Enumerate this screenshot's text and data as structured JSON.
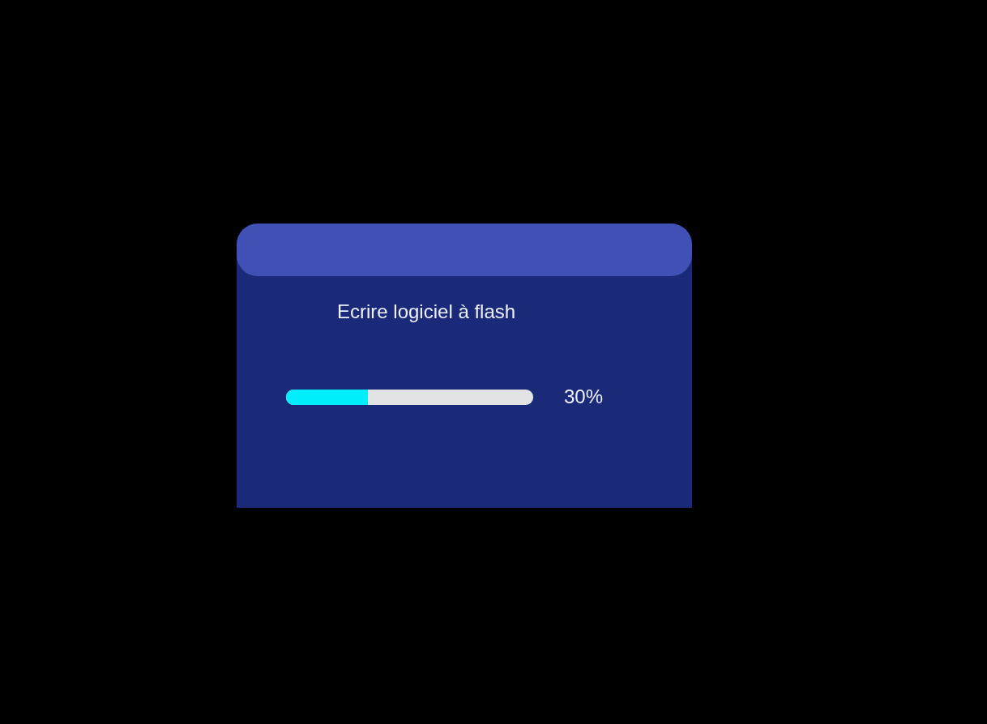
{
  "dialog": {
    "message": "Ecrire logiciel à flash",
    "progress": {
      "level": 0.33,
      "reading": "30%"
    }
  }
}
